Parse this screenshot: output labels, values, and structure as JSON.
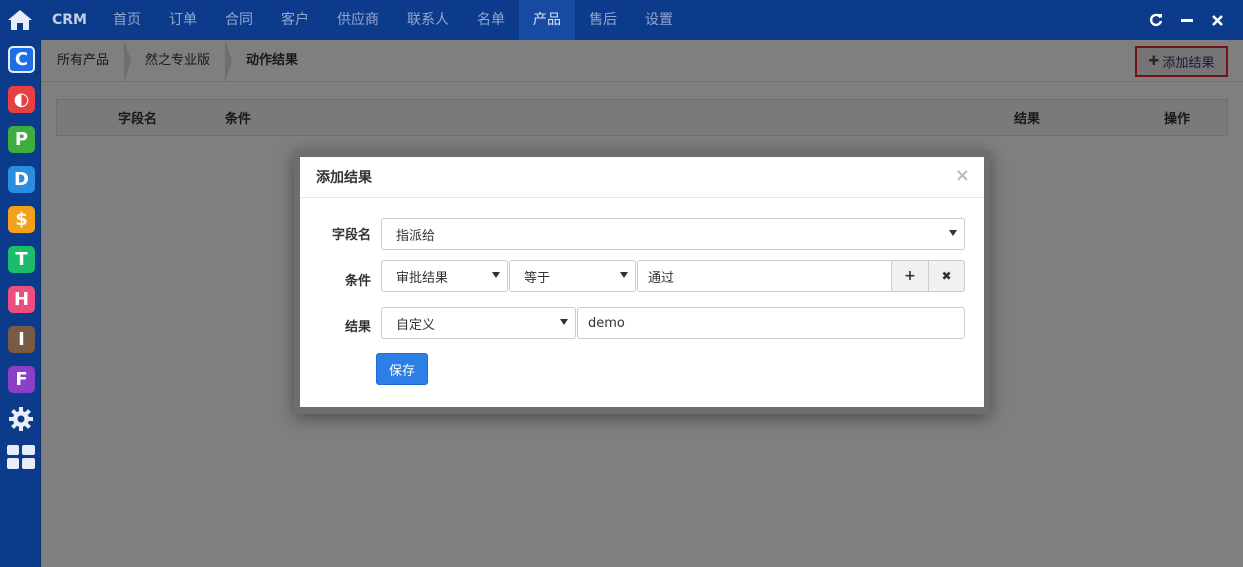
{
  "topbar": {
    "brand": "CRM",
    "nav": [
      {
        "label": "首页",
        "active": false
      },
      {
        "label": "订单",
        "active": false
      },
      {
        "label": "合同",
        "active": false
      },
      {
        "label": "客户",
        "active": false
      },
      {
        "label": "供应商",
        "active": false
      },
      {
        "label": "联系人",
        "active": false
      },
      {
        "label": "名单",
        "active": false
      },
      {
        "label": "产品",
        "active": true
      },
      {
        "label": "售后",
        "active": false
      },
      {
        "label": "设置",
        "active": false
      }
    ],
    "actions": [
      "refresh-icon",
      "minimize-icon",
      "close-icon"
    ]
  },
  "sidebar": {
    "apps": [
      {
        "letter": "C",
        "color": "#1e6ee8",
        "icon": "app-c-icon"
      },
      {
        "letter": "◐",
        "color": "#e84040",
        "icon": "app-circle-icon"
      },
      {
        "letter": "P",
        "color": "#3dae3d",
        "icon": "app-p-icon"
      },
      {
        "letter": "D",
        "color": "#2a8de0",
        "icon": "app-d-icon"
      },
      {
        "letter": "$",
        "color": "#f2a21a",
        "icon": "app-dollar-icon"
      },
      {
        "letter": "T",
        "color": "#1bbd6b",
        "icon": "app-t-icon"
      },
      {
        "letter": "H",
        "color": "#ea4f7e",
        "icon": "app-h-icon"
      },
      {
        "letter": "I",
        "color": "#7b5a45",
        "icon": "app-i-icon"
      },
      {
        "letter": "F",
        "color": "#8a3fc7",
        "icon": "app-f-icon"
      }
    ]
  },
  "breadcrumb": {
    "items": [
      "所有产品",
      "然之专业版",
      "动作结果"
    ]
  },
  "toolbar": {
    "add_result_label": "添加结果"
  },
  "table": {
    "headers": [
      "字段名",
      "条件",
      "结果",
      "操作"
    ]
  },
  "modal": {
    "title": "添加结果",
    "close_label": "×",
    "field_label": "字段名",
    "field_value": "指派给",
    "condition_label": "条件",
    "condition_field": "审批结果",
    "condition_operator": "等于",
    "condition_value": "通过",
    "add_condition_label": "+",
    "remove_condition_label": "✖",
    "result_label": "结果",
    "result_type": "自定义",
    "result_value": "demo",
    "save_label": "保存"
  },
  "colors": {
    "nav_bg": "#0d3b8c",
    "primary_button": "#2d7fe8",
    "highlight_border": "#e8232b"
  }
}
